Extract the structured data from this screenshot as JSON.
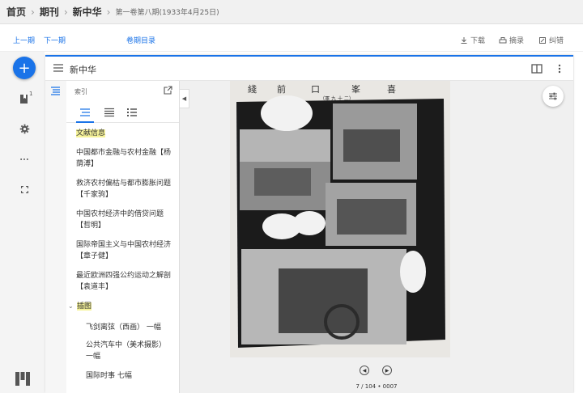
{
  "breadcrumb": {
    "home": "首页",
    "journals": "期刊",
    "magazine": "新中华",
    "issue": "第一卷第八期(1933年4月25日)"
  },
  "toolbar": {
    "prev": "上一期",
    "next": "下一期",
    "contents": "卷期目录",
    "download": "下载",
    "excerpt": "摘录",
    "correction": "纠错"
  },
  "rail": {
    "add": "+",
    "badge": "1"
  },
  "reader": {
    "title": "新中华"
  },
  "toc": {
    "label": "索引",
    "items": [
      {
        "text": "文献信息",
        "highlight": true
      },
      {
        "text": "中国都市金融与农村金融【杨荫溥】"
      },
      {
        "text": "救济农村偏枯与都市膨胀问题【千家驹】"
      },
      {
        "text": "中国农村经济中的借贷问题【哲明】"
      },
      {
        "text": "国际帝国主义与中国农村经济【章子健】"
      },
      {
        "text": "最近欧洲四强公约运动之解剖【袁道丰】"
      },
      {
        "text": "插图",
        "highlight": true,
        "expanded": true
      },
      {
        "text": "飞剑离弦（西画） 一幅"
      },
      {
        "text": "公共汽车中（美术摄影）一幅"
      },
      {
        "text": "国际时事 七幅"
      }
    ]
  },
  "page_image": {
    "header_left": "綫",
    "header_mid1": "前",
    "header_mid2": "口",
    "header_right1": "峯",
    "header_right2": "喜",
    "subtitle": "（軍 九 十 二）"
  },
  "pager": {
    "prev": "◀",
    "next": "▶",
    "indicator": "7 / 104 • 0007"
  }
}
